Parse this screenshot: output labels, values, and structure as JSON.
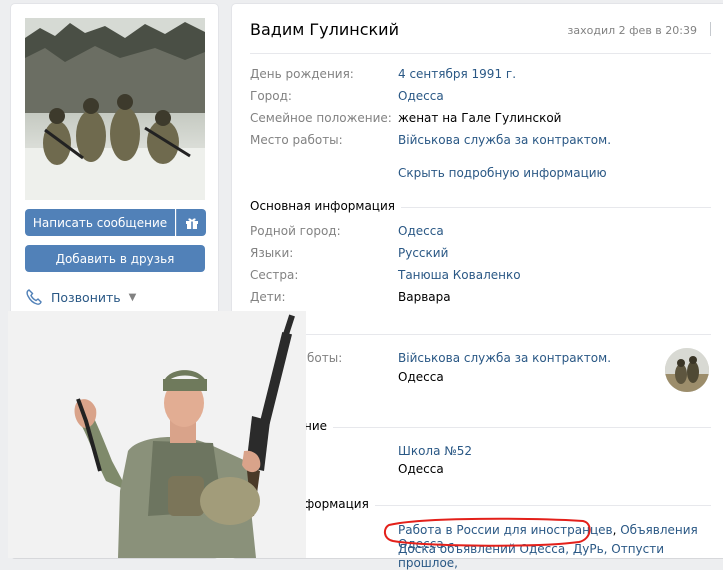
{
  "left": {
    "buttons": {
      "message": "Написать сообщение",
      "add_friend": "Добавить в друзья"
    },
    "call": {
      "label": "Позвонить"
    }
  },
  "profile": {
    "name": "Вадим Гулинский",
    "last_seen": "заходил 2 фев в 20:39",
    "summary": [
      {
        "key": "День рождения:",
        "value": "4 сентября 1991 г."
      },
      {
        "key": "Город:",
        "value": "Одесса"
      },
      {
        "key": "Семейное положение:",
        "value": "женат на Гале Гулинской"
      },
      {
        "key": "Место работы:",
        "value": "Військова служба за контрактом."
      }
    ],
    "details_link": "Скрыть подробную информацию",
    "main_info": {
      "title": "Основная информация",
      "rows": [
        {
          "key": "Родной город:",
          "value": "Одесса"
        },
        {
          "key": "Языки:",
          "value": "Русский"
        },
        {
          "key": "Сестра:",
          "value": "Танюша Коваленко"
        },
        {
          "key": "Дети:",
          "value": "Варвара"
        }
      ]
    },
    "career": {
      "key_partial": "боты:",
      "place": "Військова служба за контрактом.",
      "city": "Одесса"
    },
    "education": {
      "title_partial": "ние",
      "school": "Школа №52",
      "city": "Одесса"
    },
    "personal": {
      "title_partial": "формация",
      "line1_a": "Работа в России для иностранцев",
      "line1_b": "Объявления Одесса",
      "line2": "Доска объявлений Одесса, ДуРь, Отпусти прошлое,"
    }
  },
  "colors": {
    "accent": "#5181b8",
    "link": "#2a5885",
    "muted": "#828282",
    "highlight": "#e3201a"
  }
}
